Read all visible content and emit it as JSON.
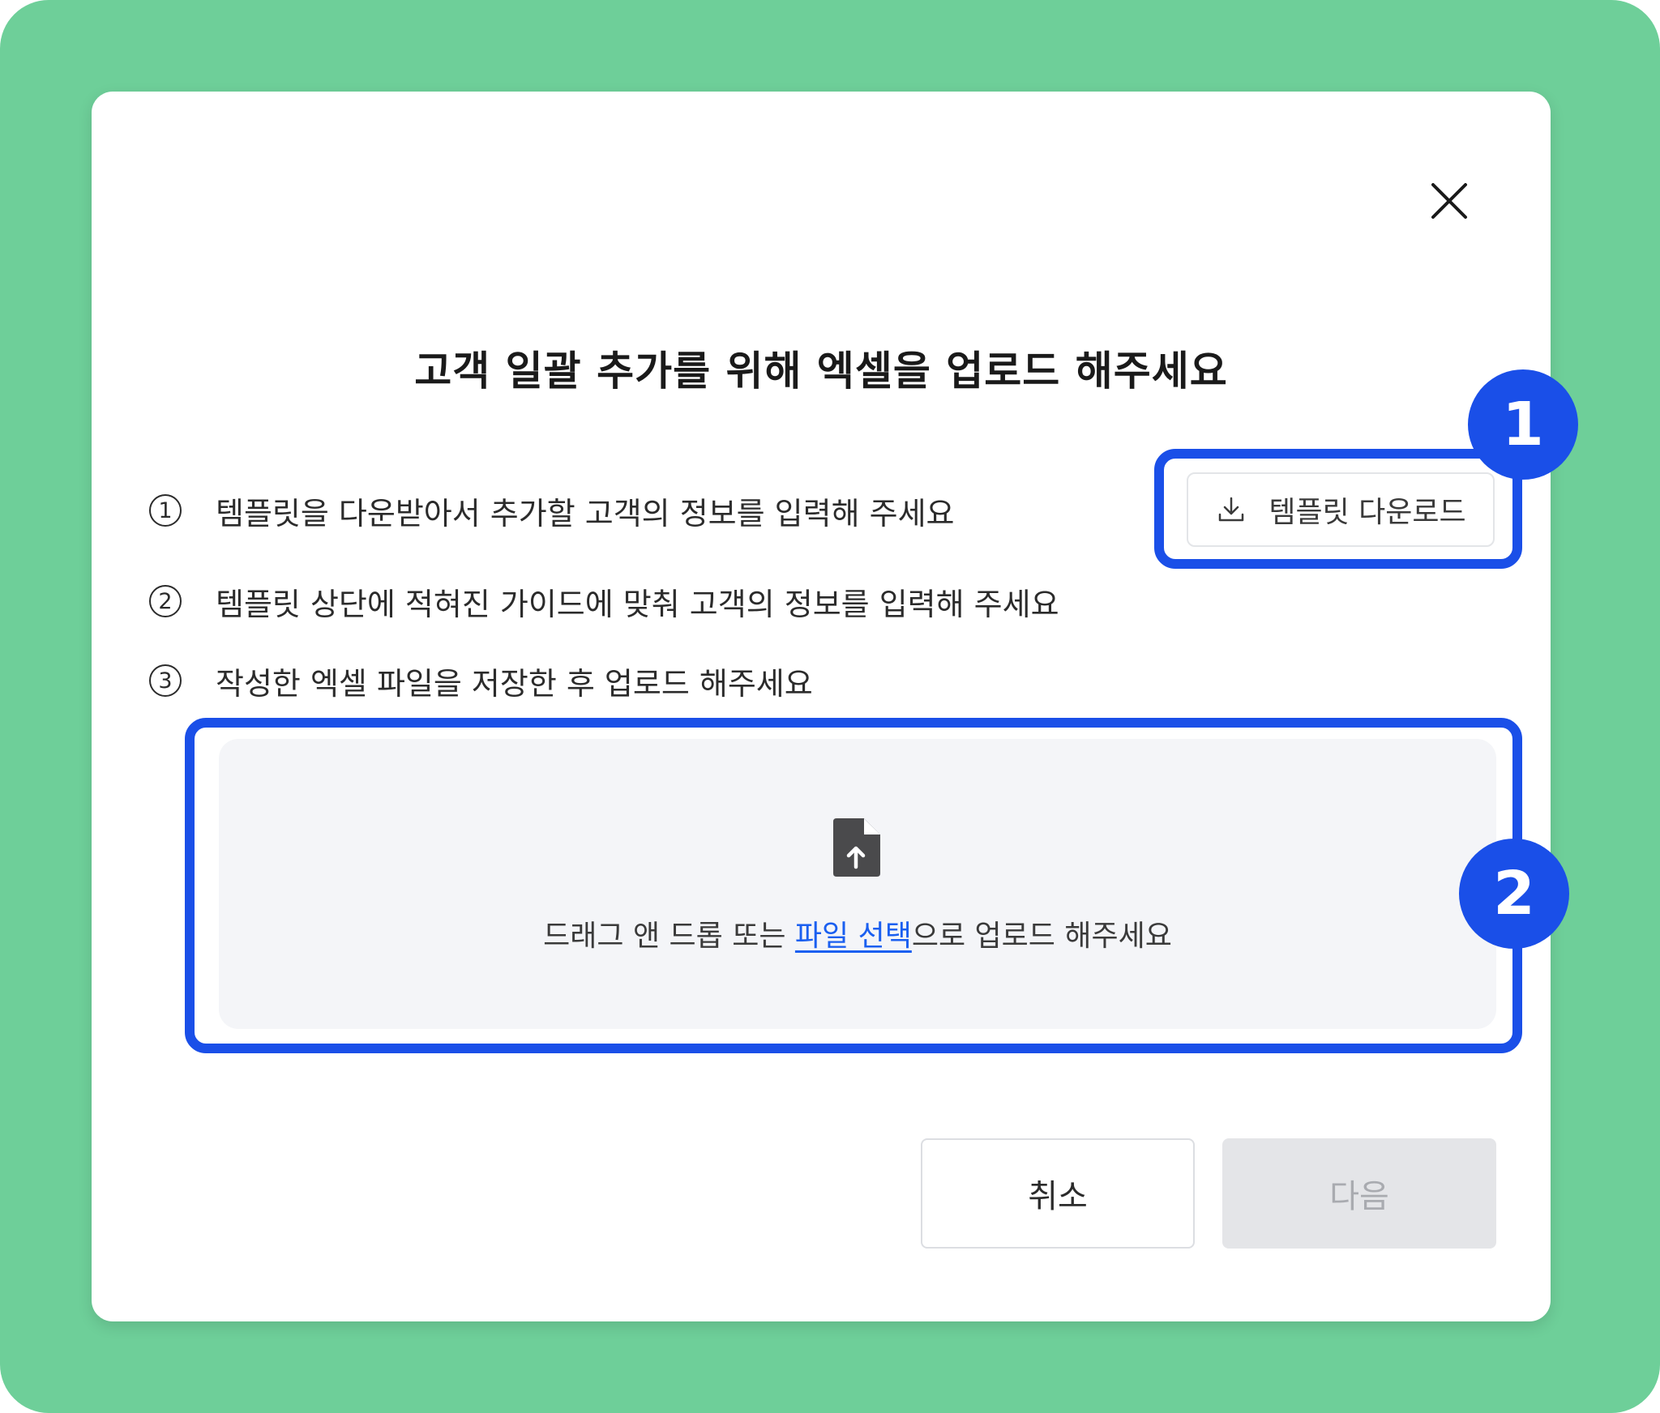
{
  "dialog": {
    "title": "고객 일괄 추가를 위해 엑셀을 업로드 해주세요",
    "close_icon": "close-icon"
  },
  "steps": [
    {
      "number": "1",
      "text": "템플릿을 다운받아서 추가할 고객의 정보를 입력해 주세요"
    },
    {
      "number": "2",
      "text": "템플릿 상단에 적혀진 가이드에 맞춰 고객의 정보를 입력해 주세요"
    },
    {
      "number": "3",
      "text": "작성한 엑셀 파일을 저장한 후 업로드 해주세요"
    }
  ],
  "template_button": {
    "icon": "download-icon",
    "label": "템플릿 다운로드"
  },
  "dropzone": {
    "icon": "file-upload-icon",
    "text_before": "드래그 앤 드롭 또는 ",
    "link": "파일 선택",
    "text_after": "으로 업로드 해주세요"
  },
  "footer": {
    "cancel_label": "취소",
    "next_label": "다음"
  },
  "annotations": {
    "marker_1": "1",
    "marker_2": "2"
  },
  "colors": {
    "background": "#6ecf99",
    "highlight": "#1a4fe8",
    "link": "#1a5ff0",
    "dropzone": "#f4f5f8",
    "disabled_button": "#e4e5e8"
  }
}
